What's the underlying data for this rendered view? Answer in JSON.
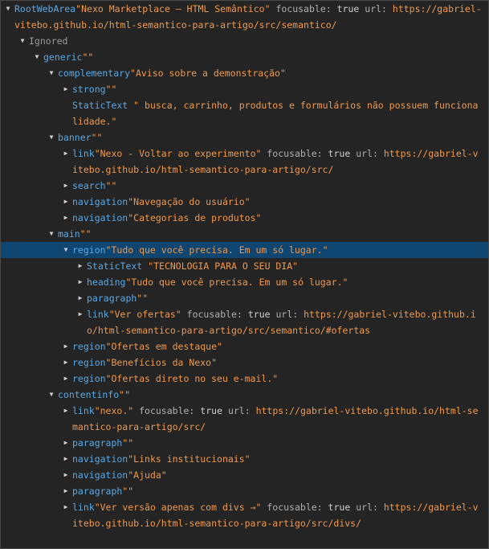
{
  "nodes": [
    {
      "indent": 0,
      "tog": "down",
      "role": "RootWebArea",
      "name": "\"Nexo Marketplace – HTML Semântico\"",
      "props": [
        {
          "k": "focusable:",
          "v": "true"
        },
        {
          "k": "url:",
          "v": "https://gabriel-vitebo.github.io/html-semantico-para-artigo/src/semantico/"
        }
      ],
      "h": 2
    },
    {
      "indent": 1,
      "tog": "down",
      "role": "Ignored",
      "ignored": true,
      "name": "",
      "props": [],
      "h": 1
    },
    {
      "indent": 2,
      "tog": "down",
      "role": "generic",
      "name": "\"\"",
      "props": [],
      "h": 1
    },
    {
      "indent": 3,
      "tog": "down",
      "role": "complementary",
      "name": "\"Aviso sobre a demonstração\"",
      "props": [],
      "h": 1
    },
    {
      "indent": 4,
      "tog": "right",
      "role": "strong",
      "name": "\"\"",
      "props": [],
      "h": 1
    },
    {
      "indent": 4,
      "tog": "none",
      "role": "StaticText",
      "name": "\" busca, carrinho, produtos e formulários não possuem funcionalidade.\"",
      "props": [],
      "h": 2
    },
    {
      "indent": 3,
      "tog": "down",
      "role": "banner",
      "name": "\"\"",
      "props": [],
      "h": 1
    },
    {
      "indent": 4,
      "tog": "right",
      "role": "link",
      "name": "\"Nexo - Voltar ao experimento\"",
      "props": [
        {
          "k": "focusable:",
          "v": "true"
        },
        {
          "k": "url:",
          "v": "https://gabriel-vitebo.github.io/html-semantico-para-artigo/src/"
        }
      ],
      "h": 2
    },
    {
      "indent": 4,
      "tog": "right",
      "role": "search",
      "name": "\"\"",
      "props": [],
      "h": 1
    },
    {
      "indent": 4,
      "tog": "right",
      "role": "navigation",
      "name": "\"Navegação do usuário\"",
      "props": [],
      "h": 1
    },
    {
      "indent": 4,
      "tog": "right",
      "role": "navigation",
      "name": "\"Categorias de produtos\"",
      "props": [],
      "h": 1
    },
    {
      "indent": 3,
      "tog": "down",
      "role": "main",
      "name": "\"\"",
      "props": [],
      "h": 1
    },
    {
      "indent": 4,
      "tog": "down",
      "role": "region",
      "name": "\"Tudo que você precisa. Em um só lugar.\"",
      "props": [],
      "h": 1,
      "selected": true
    },
    {
      "indent": 5,
      "tog": "right",
      "role": "StaticText",
      "name": "\"TECNOLOGIA PARA O SEU DIA\"",
      "props": [],
      "h": 1
    },
    {
      "indent": 5,
      "tog": "right",
      "role": "heading",
      "name": "\"Tudo que você precisa. Em um só lugar.\"",
      "props": [],
      "h": 1
    },
    {
      "indent": 5,
      "tog": "right",
      "role": "paragraph",
      "name": "\"\"",
      "props": [],
      "h": 1
    },
    {
      "indent": 5,
      "tog": "right",
      "role": "link",
      "name": "\"Ver ofertas\"",
      "props": [
        {
          "k": "focusable:",
          "v": "true"
        },
        {
          "k": "url:",
          "v": "https://gabriel-vitebo.github.io/html-semantico-para-artigo/src/semantico/#ofertas"
        }
      ],
      "h": 2
    },
    {
      "indent": 4,
      "tog": "right",
      "role": "region",
      "name": "\"Ofertas em destaque\"",
      "props": [],
      "h": 1
    },
    {
      "indent": 4,
      "tog": "right",
      "role": "region",
      "name": "\"Benefícios da Nexo\"",
      "props": [],
      "h": 1
    },
    {
      "indent": 4,
      "tog": "right",
      "role": "region",
      "name": "\"Ofertas direto no seu e-mail.\"",
      "props": [],
      "h": 1
    },
    {
      "indent": 3,
      "tog": "down",
      "role": "contentinfo",
      "name": "\"\"",
      "props": [],
      "h": 1
    },
    {
      "indent": 4,
      "tog": "right",
      "role": "link",
      "name": "\"nexo.\"",
      "props": [
        {
          "k": "focusable:",
          "v": "true"
        },
        {
          "k": "url:",
          "v": "https://gabriel-vitebo.github.io/html-semantico-para-artigo/src/"
        }
      ],
      "h": 2
    },
    {
      "indent": 4,
      "tog": "right",
      "role": "paragraph",
      "name": "\"\"",
      "props": [],
      "h": 1
    },
    {
      "indent": 4,
      "tog": "right",
      "role": "navigation",
      "name": "\"Links institucionais\"",
      "props": [],
      "h": 1
    },
    {
      "indent": 4,
      "tog": "right",
      "role": "navigation",
      "name": "\"Ajuda\"",
      "props": [],
      "h": 1
    },
    {
      "indent": 4,
      "tog": "right",
      "role": "paragraph",
      "name": "\"\"",
      "props": [],
      "h": 1
    },
    {
      "indent": 4,
      "tog": "right",
      "role": "link",
      "name": "\"Ver versão apenas com divs →\"",
      "props": [
        {
          "k": "focusable:",
          "v": "true"
        },
        {
          "k": "url:",
          "v": "https://gabriel-vitebo.github.io/html-semantico-para-artigo/src/divs/"
        }
      ],
      "h": 2
    }
  ]
}
